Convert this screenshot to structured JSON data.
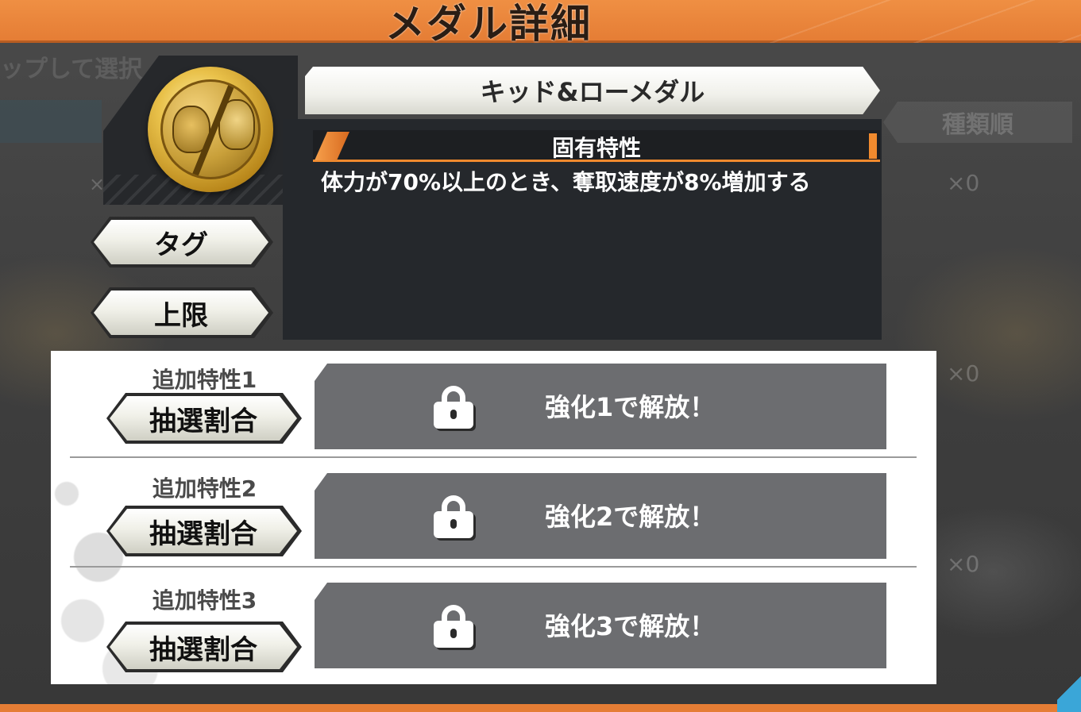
{
  "header": {
    "title": "メダル詳細"
  },
  "background": {
    "hint_text": "ップして選択",
    "sort_label": "種類順",
    "counts": [
      "×0",
      "×0",
      "×0"
    ],
    "left_count": "×"
  },
  "medal": {
    "name": "キッド&ローメダル",
    "icon": "medal-portrait-icon"
  },
  "side_buttons": {
    "tag_label": "タグ",
    "limit_label": "上限"
  },
  "unique_trait": {
    "header": "固有特性",
    "description": "体力が70%以上のとき、奪取速度が8%増加する"
  },
  "additional_traits": [
    {
      "title": "追加特性1",
      "button_label": "抽選割合",
      "lock_text": "強化1で解放！"
    },
    {
      "title": "追加特性2",
      "button_label": "抽選割合",
      "lock_text": "強化2で解放！"
    },
    {
      "title": "追加特性3",
      "button_label": "抽選割合",
      "lock_text": "強化3で解放！"
    }
  ],
  "colors": {
    "accent_orange": "#e57d35",
    "panel_dark": "#25282c",
    "lock_gray": "#6c6d70"
  }
}
